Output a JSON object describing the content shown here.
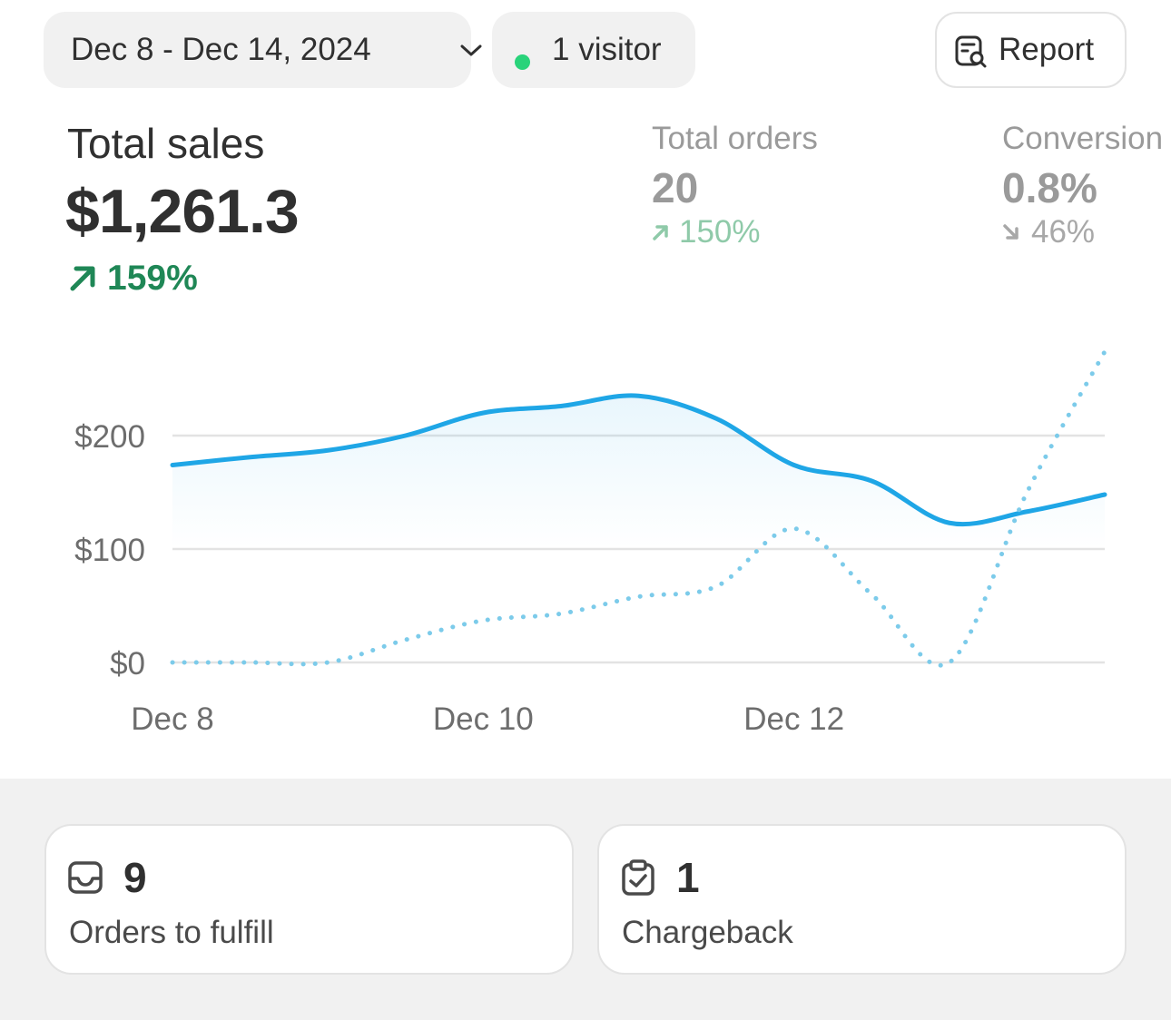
{
  "header": {
    "date_range": "Dec 8 - Dec 14, 2024",
    "visitors": "1 visitor",
    "report_label": "Report"
  },
  "metrics": {
    "sales": {
      "label": "Total sales",
      "value": "$1,261.3",
      "change": "159%",
      "direction": "up"
    },
    "orders": {
      "label": "Total orders",
      "value": "20",
      "change": "150%",
      "direction": "up"
    },
    "conversion": {
      "label": "Conversion",
      "value": "0.8%",
      "change": "46%",
      "direction": "down"
    }
  },
  "chart_data": {
    "type": "line",
    "x": [
      "Dec 8",
      "Dec 8.5",
      "Dec 9",
      "Dec 9.5",
      "Dec 10",
      "Dec 10.5",
      "Dec 11",
      "Dec 11.5",
      "Dec 12",
      "Dec 12.5",
      "Dec 13",
      "Dec 13.5",
      "Dec 14"
    ],
    "x_ticks": [
      "Dec 8",
      "Dec 10",
      "Dec 12"
    ],
    "y_ticks": [
      "$0",
      "$100",
      "$200"
    ],
    "ylim": [
      0,
      280
    ],
    "grid": true,
    "series": [
      {
        "style": "solid",
        "color": "#1fa6e6",
        "values": [
          174,
          181,
          187,
          200,
          220,
          226,
          235,
          215,
          174,
          160,
          123,
          133,
          148
        ]
      },
      {
        "style": "dotted",
        "color": "#7ccbea",
        "values": [
          0,
          0,
          0,
          20,
          37,
          43,
          58,
          67,
          118,
          60,
          0,
          150,
          274
        ]
      }
    ]
  },
  "cards": [
    {
      "count": "9",
      "label": "Orders to fulfill",
      "icon": "inbox-icon"
    },
    {
      "count": "1",
      "label": "Chargeback",
      "icon": "clipboard-check-icon"
    }
  ],
  "colors": {
    "accent_line": "#1fa6e6",
    "comparison_line": "#7ccbea",
    "positive": "#1f8756",
    "visitor_dot": "#29d37a"
  }
}
